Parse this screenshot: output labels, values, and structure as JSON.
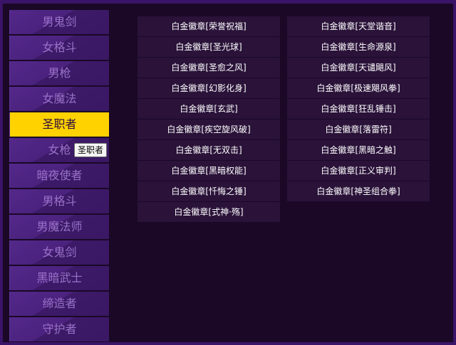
{
  "sidebar": {
    "items": [
      {
        "label": "男鬼剑",
        "active": false
      },
      {
        "label": "女格斗",
        "active": false
      },
      {
        "label": "男枪",
        "active": false
      },
      {
        "label": "女魔法",
        "active": false
      },
      {
        "label": "圣职者",
        "active": true
      },
      {
        "label": "女枪",
        "active": false
      },
      {
        "label": "暗夜使者",
        "active": false
      },
      {
        "label": "男格斗",
        "active": false
      },
      {
        "label": "男魔法师",
        "active": false
      },
      {
        "label": "女鬼剑",
        "active": false
      },
      {
        "label": "黑暗武士",
        "active": false
      },
      {
        "label": "缔造者",
        "active": false
      },
      {
        "label": "守护者",
        "active": false
      }
    ]
  },
  "tooltip": {
    "text": "圣职者"
  },
  "emblems": {
    "left": [
      "白金徽章[荣誉祝福]",
      "白金徽章[圣光球]",
      "白金徽章[圣愈之风]",
      "白金徽章[幻影化身]",
      "白金徽章[玄武]",
      "白金徽章[疾空旋风破]",
      "白金徽章[无双击]",
      "白金徽章[黑暗权能]",
      "白金徽章[忏悔之锤]",
      "白金徽章[式神·殇]"
    ],
    "right": [
      "白金徽章[天堂谐音]",
      "白金徽章[生命源泉]",
      "白金徽章[天谴飓风]",
      "白金徽章[极速飓风拳]",
      "白金徽章[狂乱锤击]",
      "白金徽章[落雷符]",
      "白金徽章[黑暗之触]",
      "白金徽章[正义审判]",
      "白金徽章[神圣组合拳]"
    ]
  }
}
